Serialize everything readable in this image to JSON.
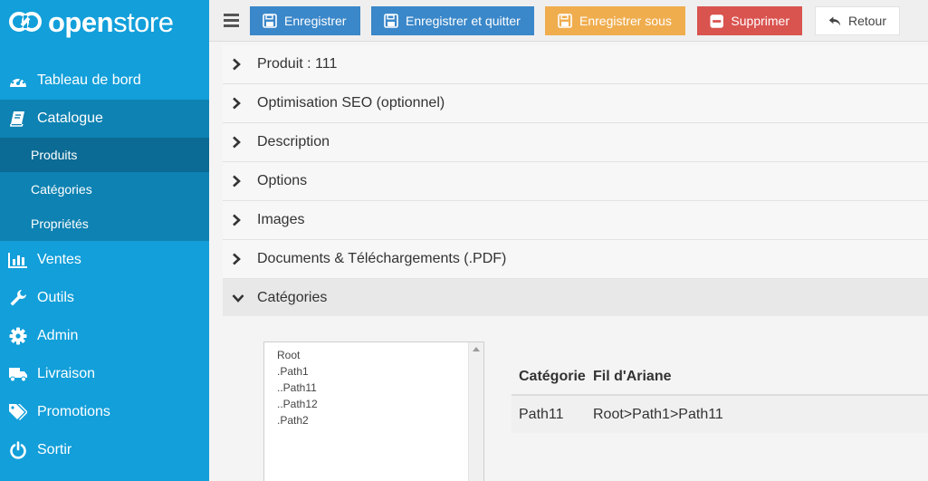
{
  "brand": {
    "bold": "open",
    "light": "store"
  },
  "sidebar": {
    "items": [
      {
        "label": "Tableau de bord",
        "icon": "dashboard-icon"
      },
      {
        "label": "Catalogue",
        "icon": "book-icon"
      },
      {
        "label": "Ventes",
        "icon": "bar-chart-icon"
      },
      {
        "label": "Outils",
        "icon": "wrench-icon"
      },
      {
        "label": "Admin",
        "icon": "gear-icon"
      },
      {
        "label": "Livraison",
        "icon": "truck-icon"
      },
      {
        "label": "Promotions",
        "icon": "tags-icon"
      },
      {
        "label": "Sortir",
        "icon": "power-icon"
      }
    ],
    "subitems": [
      {
        "label": "Produits"
      },
      {
        "label": "Catégories"
      },
      {
        "label": "Propriétés"
      }
    ]
  },
  "toolbar": {
    "save": "Enregistrer",
    "save_quit": "Enregistrer et quitter",
    "save_as": "Enregistrer sous",
    "delete": "Supprimer",
    "back": "Retour"
  },
  "sections": [
    {
      "label": "Produit : 111"
    },
    {
      "label": "Optimisation SEO (optionnel)"
    },
    {
      "label": "Description"
    },
    {
      "label": "Options"
    },
    {
      "label": "Images"
    },
    {
      "label": "Documents & Téléchargements (.PDF)"
    },
    {
      "label": "Catégories"
    }
  ],
  "categories": {
    "tree": [
      "Root",
      ".Path1",
      "..Path11",
      "..Path12",
      ".Path2"
    ],
    "table": {
      "headers": [
        "Catégorie",
        "Fil d'Ariane"
      ],
      "rows": [
        [
          "Path11",
          "Root>Path1>Path11"
        ]
      ]
    }
  },
  "colors": {
    "sidebar": "#129fda",
    "sidebar_active": "#0e82b2",
    "primary": "#3a87c9",
    "warning": "#f0ad4e",
    "danger": "#d9534f"
  }
}
